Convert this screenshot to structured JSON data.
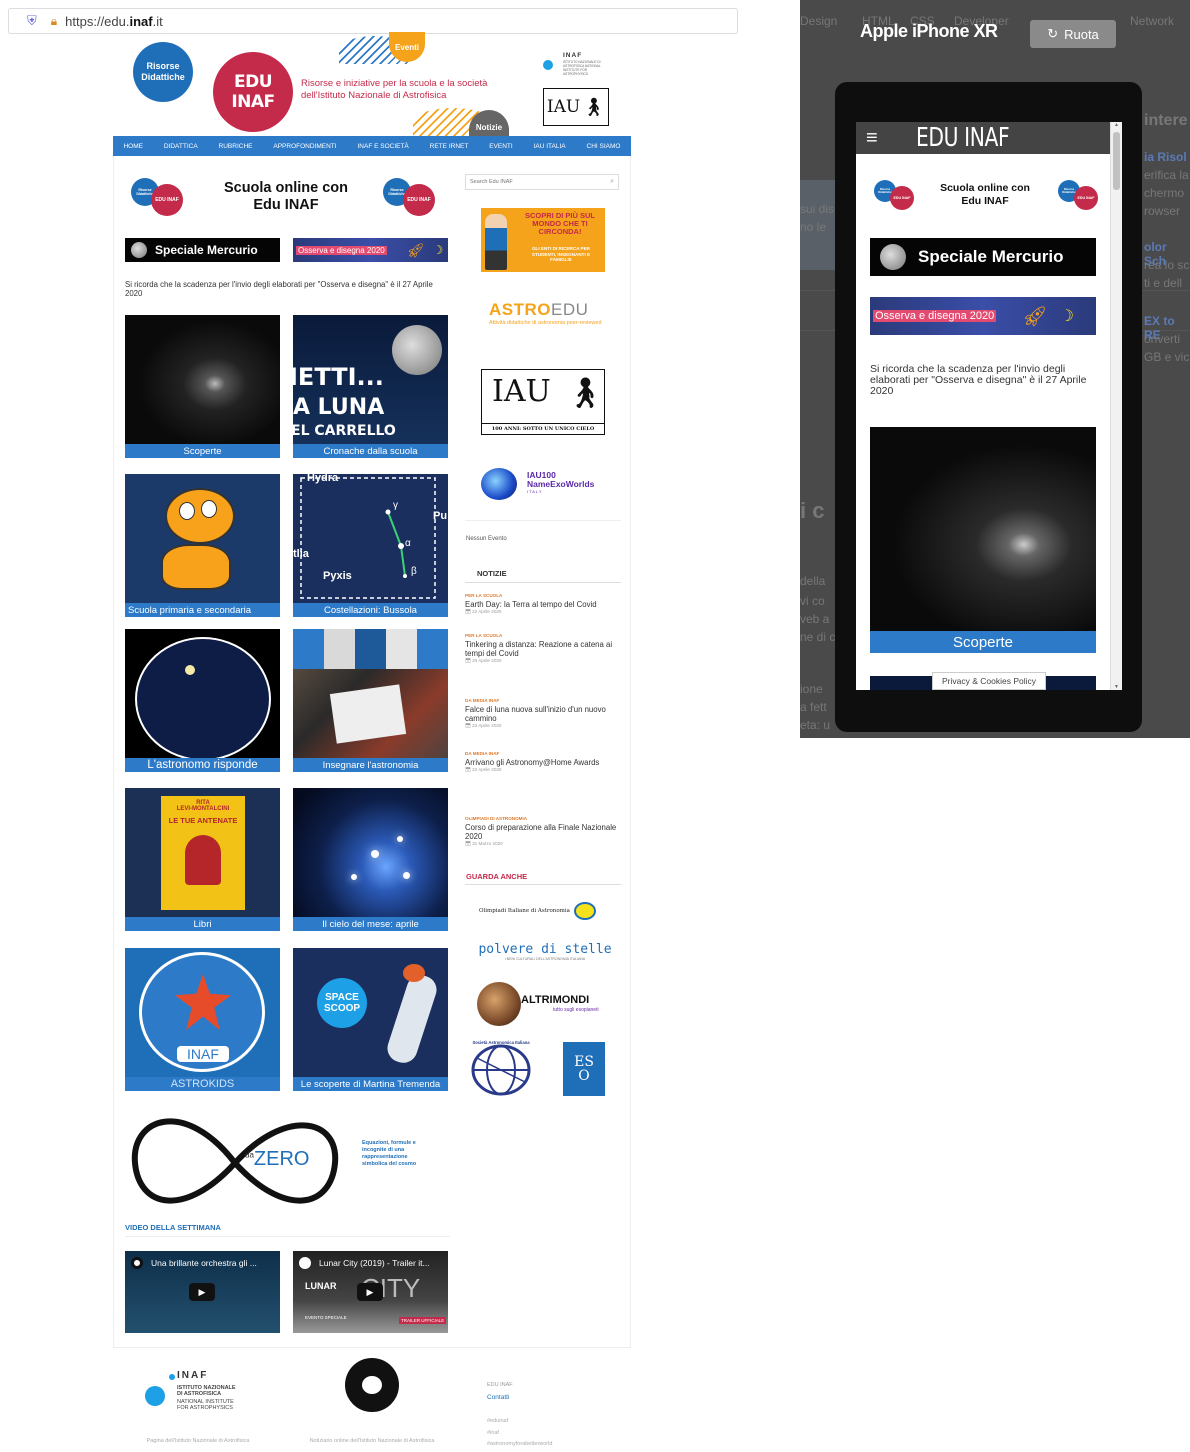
{
  "browser": {
    "url_prefix": "https://edu.",
    "url_domain": "inaf",
    "url_suffix": ".it"
  },
  "header": {
    "risorse_didattiche": "Risorse Didattiche",
    "eventi": "Eventi",
    "notizie": "Notizie",
    "edu_inaf": "EDU INAF",
    "tagline": "Risorse e iniziative per la scuola e la società dell'Istituto Nazionale di Astrofisica",
    "inaf_logo": "INAF",
    "inaf_sub": "ISTITUTO NAZIONALE DI ASTROFISICA NATIONAL INSTITUTE FOR ASTROPHYSICS",
    "iau_logo": "IAU"
  },
  "nav": [
    "HOME",
    "DIDATTICA",
    "RUBRICHE",
    "APPROFONDIMENTI",
    "INAF E SOCIETÀ",
    "RETE IRNET",
    "EVENTI",
    "IAU ITALIA",
    "CHI SIAMO"
  ],
  "main": {
    "banner_title": "Scuola online con Edu INAF",
    "badge_risorse": "Risorse Didattiche",
    "badge_edu": "EDU INAF",
    "speciale_mercurio": "Speciale Mercurio",
    "osserva": "Osserva e disegna 2020",
    "notice": "Si ricorda che la scadenza per l'invio degli elaborati per \"Osserva e disegna\" è il 27 Aprile 2020",
    "tiles": [
      "Scoperte",
      "Cronache dalla scuola",
      "Scuola primaria e secondaria",
      "Costellazioni: Bussola",
      "L'astronomo risponde",
      "Insegnare l'astronomia",
      "Libri",
      "Il cielo del mese: aprile",
      "ASTROKIDS",
      "Le scoperte di Martina Tremenda"
    ],
    "tile_texts": {
      "luna1": "IETTI...",
      "luna2": "A LUNA",
      "luna3": "EL CARRELLO",
      "hydra": "Hydra",
      "pyxis": "Pyxis",
      "pu": "Pu",
      "tlia": "tlia",
      "alpha": "α",
      "beta": "β",
      "gamma": "γ",
      "rita": "RITA",
      "levi": "LEVI-MONTALCINI",
      "antenate": "LE TUE ANTENATE",
      "inaf": "INAF",
      "space": "SPACE",
      "scoop": "SCOOP"
    },
    "dazero_da": "da",
    "dazero_zero": "ZERO",
    "dazero_text": "Equazioni, formule e incognite di una rappresentazione simbolica del cosmo",
    "video_title": "VIDEO DELLA SETTIMANA",
    "video1": "Una brillante orchestra gli ...",
    "video2": "Lunar City (2019) - Trailer it...",
    "video2_logo": "LUNAR",
    "video2_city": "CITY",
    "video2_evento": "EVENTO SPECIALE",
    "video2_trailer": "TRAILER UFFICIALE"
  },
  "sidebar": {
    "search_placeholder": "Search Edu INAF",
    "scopri": "SCOPRI DI PIÙ SUL MONDO CHE TI CIRCONDA!",
    "scopri_sub": "GLI ENTI DI RICERCA PER STUDENTI, INSEGNANTI E FAMIGLIE",
    "astroedu_a": "ASTRO",
    "astroedu_b": "EDU",
    "astroedu_sub": "Attività didattiche di astronomia peer-reviewed",
    "iau100_caption": "100 Anni: Sotto Un Unico Cielo",
    "iau100_logo": "IAU",
    "nameexo_1": "IAU100",
    "nameexo_2": "NameExoWorlds",
    "nameexo_3": "ITALY",
    "nessun_evento": "Nessun Evento",
    "notizie_title": "NOTIZIE",
    "news": [
      {
        "cat": "PER LA SCUOLA",
        "title": "Earth Day: la Terra al tempo del Covid",
        "date": "22 Aprile 2020"
      },
      {
        "cat": "PER LA SCUOLA",
        "title": "Tinkering a distanza: Reazione a catena ai tempi del Covid",
        "date": "20 Aprile 2020"
      },
      {
        "cat": "DA MEDIA INAF",
        "title": "Falce di luna nuova sull'inizio d'un nuovo cammino",
        "date": "22 Aprile 2020"
      },
      {
        "cat": "DA MEDIA INAF",
        "title": "Arrivano gli Astronomy@Home Awards",
        "date": "22 Aprile 2020"
      },
      {
        "cat": "OLIMPIADI DI ASTRONOMIA",
        "title": "Corso di preparazione alla Finale Nazionale 2020",
        "date": "31 Marzo 2020"
      }
    ],
    "guarda_title": "GUARDA ANCHE",
    "olimpiadi": "Olimpiadi Italiane di Astronomia",
    "polvere": "polvere di stelle",
    "polvere_sub": "I BENI CULTURALI DELL'ASTRONOMIA ITALIANA",
    "altrimondi": "ALTRIMONDI",
    "altrimondi_sub": "tutto sugli esopianeti",
    "sait": "Società Astronomica Italiana",
    "eso": "ES O"
  },
  "footer": {
    "inaf": "INAF",
    "inaf_l1": "ISTITUTO NAZIONALE",
    "inaf_l2": "DI ASTROFISICA",
    "inaf_l3": "NATIONAL INSTITUTE",
    "inaf_l4": "FOR ASTROPHYSICS",
    "pagina": "Pagina dell'Istituto Nazionale di Astrofisica",
    "notiziario": "Notiziario online dell'Istituto Nazionale di Astrofisica",
    "edu": "EDU INAF",
    "contatti": "Contatti",
    "tag1": "#eduinaf",
    "tag2": "#inaf",
    "tag3": "#astronomyforabetterworld"
  },
  "phone": {
    "device": "Apple iPhone XR",
    "ruota": "Ruota",
    "bg_menu": [
      "Design",
      "HTML",
      "CSS",
      "Developer",
      "Network"
    ],
    "bg_texts": [
      "intere",
      "ia Risol",
      "erifica la",
      "chermo",
      "rowser",
      "olor Sch",
      "rea lo sc",
      "ti e dell",
      "EX to RE",
      "onverti",
      "GB e vic",
      "sui dis",
      "no le",
      "i c",
      "della",
      "vi co",
      "veb a",
      "ne di c",
      "ione",
      "a fett",
      "eta: u"
    ],
    "logo": "EDU INAF",
    "banner_title": "Scuola online con Edu INAF",
    "badge_risorse": "Risorse Didattiche",
    "badge_edu": "EDU INAF",
    "speciale_mercurio": "Speciale Mercurio",
    "osserva": "Osserva e disegna 2020",
    "notice": "Si ricorda che la scadenza per l'invio degli elaborati per \"Osserva e disegna\" è il 27 Aprile 2020",
    "tile": "Scoperte",
    "privacy": "Privacy & Cookies Policy"
  },
  "colors": {
    "nav_blue": "#2d7ac8",
    "red": "#c42a4a",
    "blue": "#1f6fb8",
    "orange": "#f5a31a"
  }
}
